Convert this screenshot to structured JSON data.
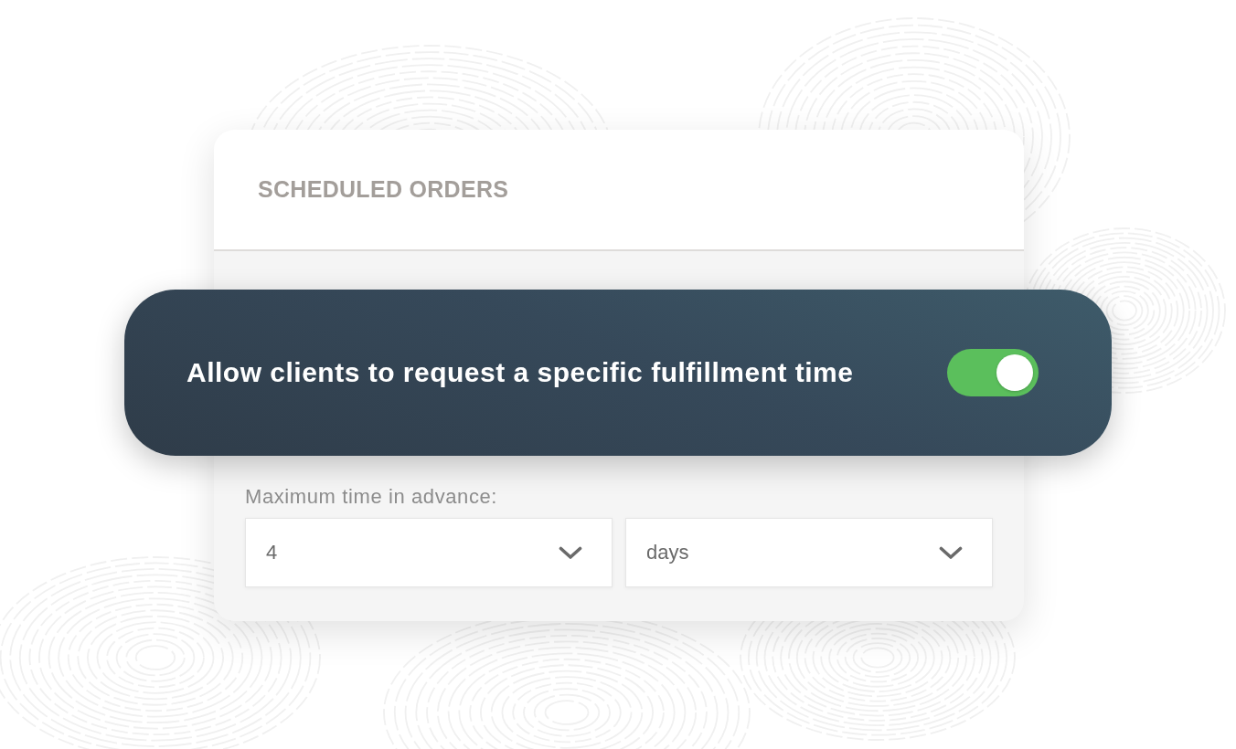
{
  "card": {
    "title": "SCHEDULED ORDERS",
    "max_advance": {
      "label": "Maximum time in advance:",
      "amount": "4",
      "unit": "days"
    }
  },
  "banner": {
    "label": "Allow clients to request a specific fulfillment time",
    "on": true
  }
}
